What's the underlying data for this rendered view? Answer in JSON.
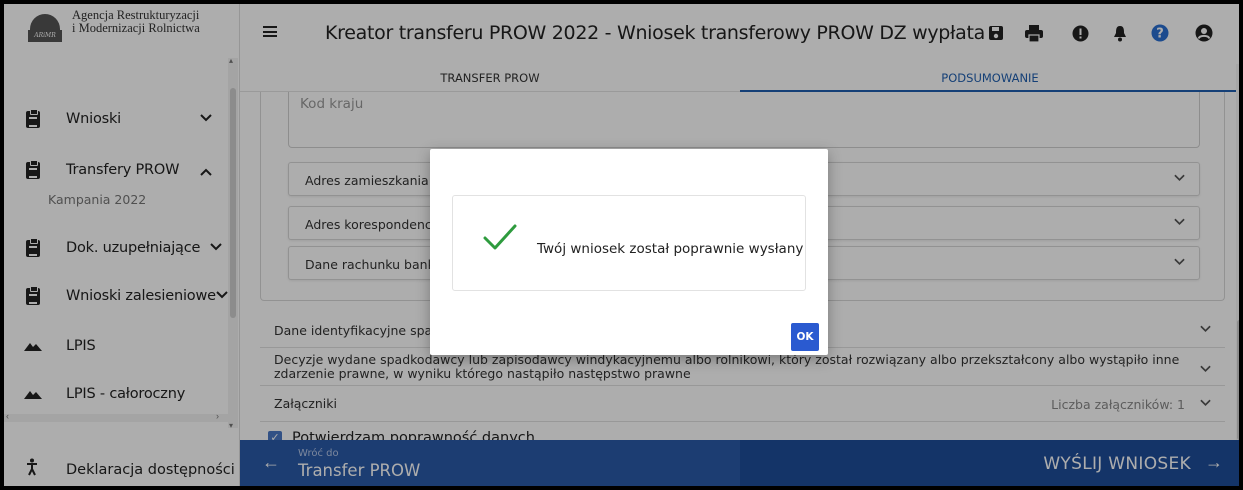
{
  "logo": {
    "line1": "Agencja Restrukturyzacji",
    "line2": "i Modernizacji Rolnictwa",
    "mark_text": "ARiMR"
  },
  "sidebar": {
    "items": [
      {
        "label": "Wnioski",
        "icon": "clipboard-icon",
        "chevron": "⌄"
      },
      {
        "label": "Transfery PROW",
        "icon": "clipboard-icon",
        "chevron": "^"
      },
      {
        "label": "Dok. uzupełniające",
        "icon": "clipboard-icon",
        "chevron": "⌄"
      },
      {
        "label": "Wnioski zalesieniowe",
        "icon": "clipboard-icon",
        "chevron": "⌄"
      },
      {
        "label": "LPIS",
        "icon": "mountain-icon"
      },
      {
        "label": "LPIS - całoroczny",
        "icon": "mountain-icon"
      }
    ],
    "sub_item": "Kampania 2022",
    "accessibility": "Deklaracja dostępności"
  },
  "header": {
    "title": "Kreator transferu PROW 2022 - Wniosek transferowy PROW DZ wypłata",
    "icons": [
      "save-icon",
      "print-icon",
      "alert-icon",
      "bell-icon",
      "help-icon",
      "user-icon"
    ],
    "help_color": "#2a6fd1"
  },
  "tabs": [
    {
      "label": "TRANSFER PROW"
    },
    {
      "label": "PODSUMOWANIE"
    }
  ],
  "form": {
    "kod_kraju_label": "Kod kraju",
    "sections": [
      {
        "label": "Adres zamieszkania"
      },
      {
        "label": "Adres korespondencyjny"
      },
      {
        "label": "Dane rachunku bankowego"
      }
    ],
    "rows": [
      {
        "label": "Dane identyfikacyjne spadkobiercy"
      },
      {
        "label_line1": "Decyzje wydane spadkodawcy lub zapisodawcy windykacyjnemu albo rolnikowi, który został rozwiązany albo przekształcony albo wystąpiło inne",
        "label_line2": "zdarzenie prawne, w wyniku którego nastąpiło następstwo prawne"
      },
      {
        "label": "Załączniki",
        "meta": "Liczba załączników: 1"
      }
    ],
    "confirm_label": "Potwierdzam poprawność danych"
  },
  "bottom": {
    "back_small": "Wróć do",
    "back_big": "Transfer PROW",
    "send_label": "WYŚLIJ WNIOSEK",
    "arrow_left": "←",
    "arrow_right": "→",
    "accent": "#1e4d9a"
  },
  "modal": {
    "message": "Twój wniosek został poprawnie wysłany",
    "ok_label": "OK",
    "check_color": "#2e9b3e"
  }
}
